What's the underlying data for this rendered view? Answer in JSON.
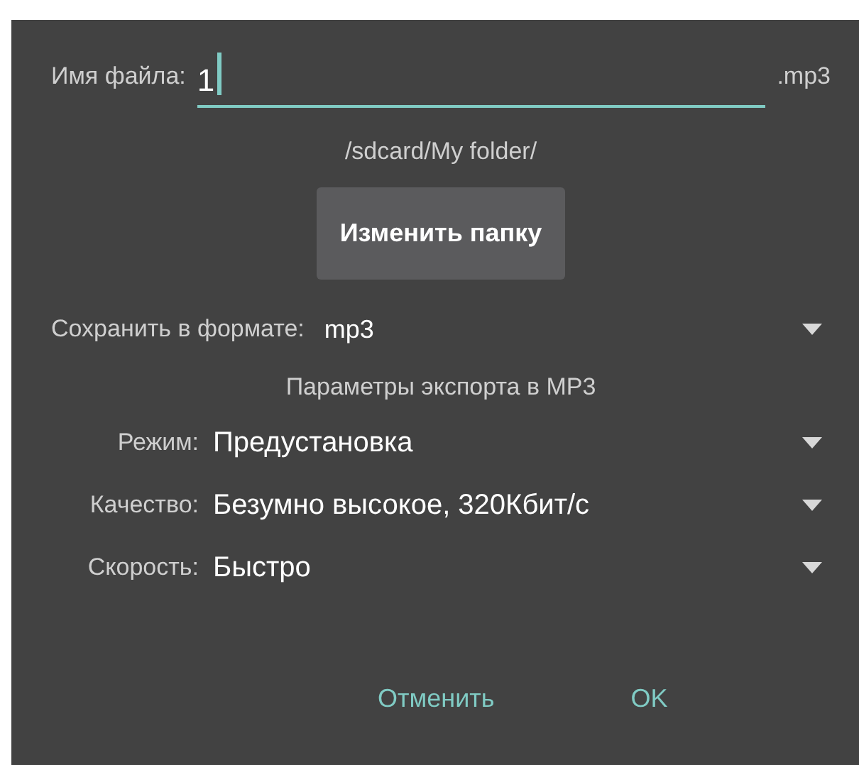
{
  "filename": {
    "label": "Имя файла:",
    "value": "1",
    "focused": true,
    "extension": ".mp3"
  },
  "folder_path": "/sdcard/My folder/",
  "change_folder_button": "Изменить папку",
  "format": {
    "label": "Сохранить в формате:",
    "value": "mp3"
  },
  "export_section_title": "Параметры экспорта в MP3",
  "options": [
    {
      "label": "Режим:",
      "value": "Предустановка"
    },
    {
      "label": "Качество:",
      "value": "Безумно высокое, 320Кбит/с"
    },
    {
      "label": "Скорость:",
      "value": "Быстро"
    }
  ],
  "buttons": [
    "Отменить",
    "OK"
  ]
}
